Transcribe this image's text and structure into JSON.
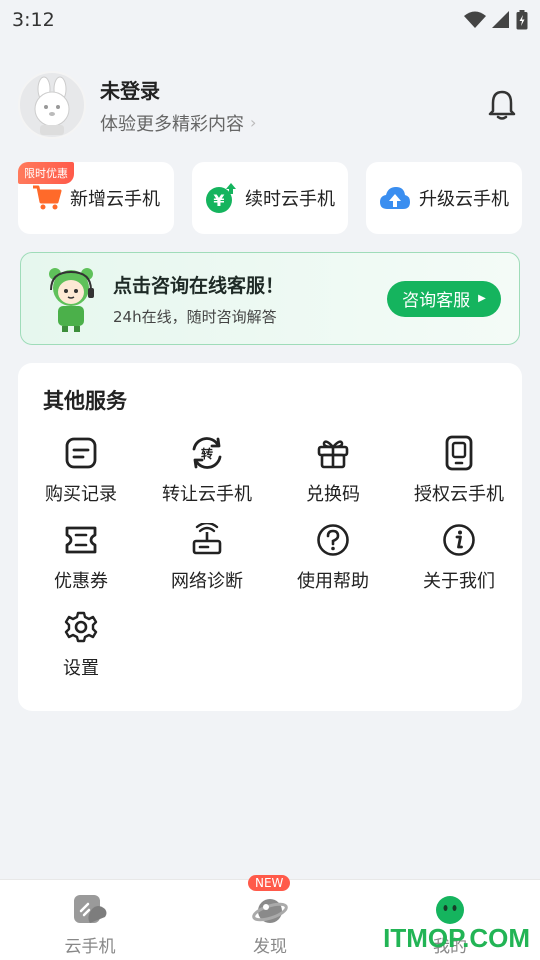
{
  "status_bar": {
    "time": "3:12"
  },
  "profile": {
    "name": "未登录",
    "subtitle": "体验更多精彩内容",
    "chevron": "›"
  },
  "actions": [
    {
      "label": "新增云手机",
      "icon": "cart-icon",
      "tag": "限时优惠"
    },
    {
      "label": "续时云手机",
      "icon": "yen-renew-icon"
    },
    {
      "label": "升级云手机",
      "icon": "cloud-upload-icon"
    }
  ],
  "service_banner": {
    "title": "点击咨询在线客服！",
    "subtitle": "24h在线，随时咨询解答",
    "button": "咨询客服"
  },
  "services": {
    "title": "其他服务",
    "items": [
      {
        "label": "购买记录",
        "icon": "purchase-record-icon"
      },
      {
        "label": "转让云手机",
        "icon": "transfer-icon"
      },
      {
        "label": "兑换码",
        "icon": "gift-icon"
      },
      {
        "label": "授权云手机",
        "icon": "authorize-phone-icon"
      },
      {
        "label": "优惠券",
        "icon": "coupon-icon"
      },
      {
        "label": "网络诊断",
        "icon": "router-icon"
      },
      {
        "label": "使用帮助",
        "icon": "help-icon"
      },
      {
        "label": "关于我们",
        "icon": "info-icon"
      },
      {
        "label": "设置",
        "icon": "settings-gear-icon"
      }
    ]
  },
  "bottom_nav": {
    "items": [
      {
        "label": "云手机",
        "icon": "cloud-phone-icon"
      },
      {
        "label": "发现",
        "icon": "discover-planet-icon",
        "badge": "NEW"
      },
      {
        "label": "我的",
        "icon": "mine-face-icon"
      }
    ]
  },
  "watermark": "ITMOP.COM",
  "colors": {
    "accent": "#15b45e",
    "promo": "#ff5a4a",
    "background": "#f1f3f6"
  }
}
